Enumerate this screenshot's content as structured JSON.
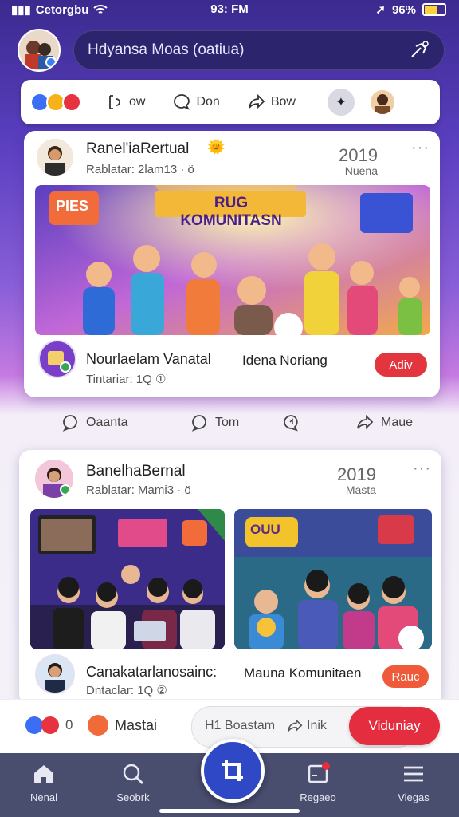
{
  "status": {
    "carrier": "Cetorgbu",
    "time": "93: FM",
    "battery": "96%"
  },
  "header": {
    "search_text": "Hdyansa Moas (oatiua)"
  },
  "composer": {
    "btn1": "ow",
    "btn2": "Don",
    "btn3": "Bow"
  },
  "post1": {
    "author": "Ranel'iaRertual",
    "subtitle": "Rablatar: 2lam13 · ö",
    "date": "2019",
    "date_sub": "Nuena",
    "banner_text": "RUG KOMUNITASN",
    "bubble_text": "PIES",
    "footer_name": "Nourlaelam Vanatal",
    "footer_meta": "Tintariar: 1Q ①",
    "footer_right": "Idena Noriang",
    "footer_button": "Adiv"
  },
  "post_actions": {
    "comment": "Oaanta",
    "tom": "Tom",
    "share": "Maue"
  },
  "post2": {
    "author": "BanelhaBernal",
    "subtitle": "Rablatar: Mami3 · ö",
    "date": "2019",
    "date_sub": "Masta",
    "img2_text": "OUU",
    "footer_name": "Canakatarlanosainc:",
    "footer_meta": "Dntaclar: 1Q ②",
    "footer_right": "Mauna Komunitaen",
    "footer_button": "Rauc"
  },
  "bottom_bar": {
    "reaction_count": "0",
    "label": "Mastai",
    "comment_placeholder": "H1 Boastam",
    "share_label": "Inik",
    "cta": "Viduniay"
  },
  "nav": {
    "item1": "Nenal",
    "item2": "Seobrk",
    "item3": "Regaeo",
    "item4": "Viegas"
  },
  "colors": {
    "accent_red": "#e42d3f",
    "nav_bg": "#494d6e",
    "fab": "#2f49c6"
  },
  "icons": [
    "wifi-icon",
    "signal-icon",
    "battery-icon",
    "search-icon",
    "like-icon",
    "comment-icon",
    "share-icon",
    "home-icon",
    "menu-icon"
  ]
}
